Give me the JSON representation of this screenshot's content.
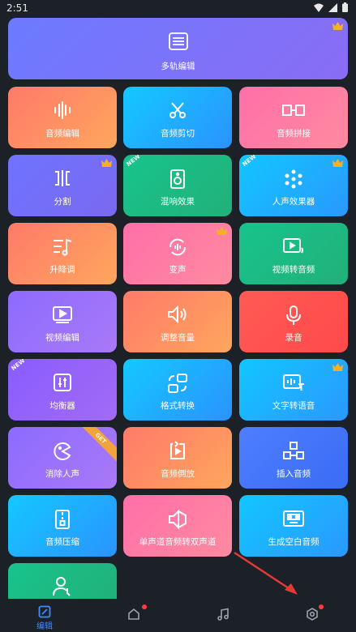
{
  "status": {
    "time": "2:51"
  },
  "tiles": {
    "multitrack": "多轨编辑",
    "audio_edit": "音频编辑",
    "audio_cut": "音频剪切",
    "audio_join": "音频拼接",
    "split": "分割",
    "reverb": "混响效果",
    "vocal_effect": "人声效果器",
    "pitch": "升降调",
    "voice_change": "变声",
    "video_to_audio": "视频转音频",
    "video_edit": "视频编辑",
    "volume": "调整音量",
    "record": "录音",
    "equalizer": "均衡器",
    "format_convert": "格式转换",
    "tts": "文字转语音",
    "remove_vocal": "消除人声",
    "reverse": "音频倒放",
    "insert_audio": "插入音频",
    "compress": "音频压缩",
    "mono_to_stereo": "单声道音频转双声道",
    "blank_audio": "生成空白音频"
  },
  "badges": {
    "new": "NEW",
    "ribbon": "GET"
  },
  "nav": {
    "edit_label": "编辑"
  },
  "colors": {
    "accent": "#3b8cff",
    "background": "#1c2128",
    "notify_dot": "#ff3b3b",
    "crown": "#f5b025"
  }
}
